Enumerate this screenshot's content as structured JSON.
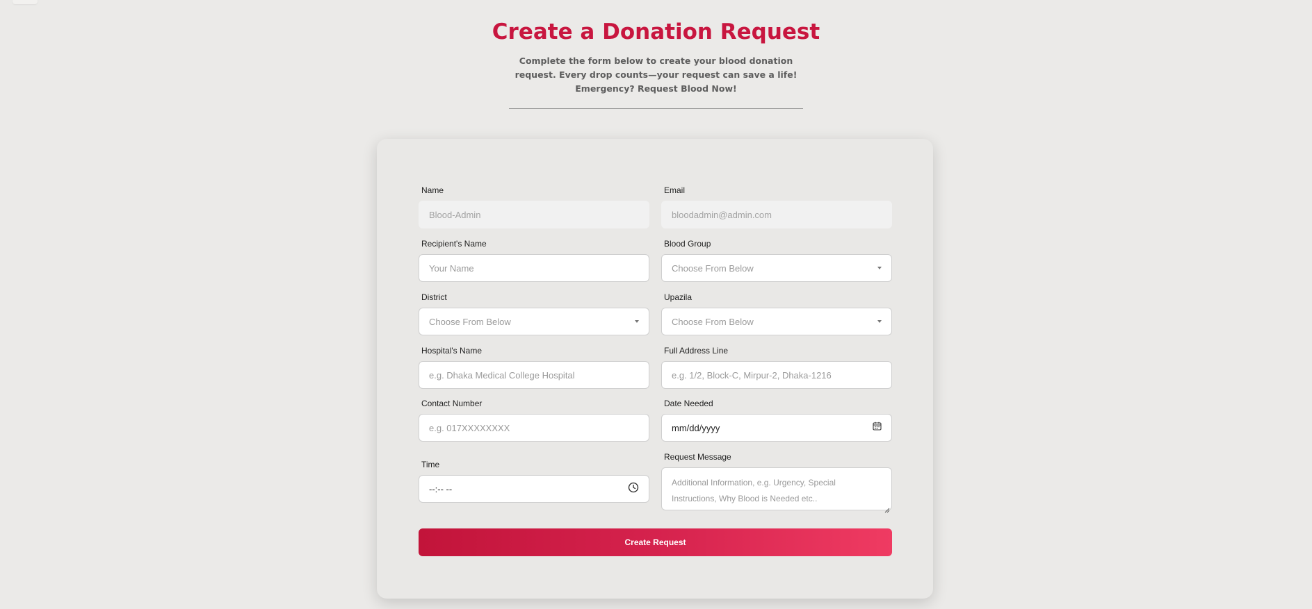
{
  "page": {
    "title": "Create a Donation Request",
    "subtitle": "Complete the form below to create your blood donation request. Every drop counts—your request can save a life! Emergency? Request Blood Now!"
  },
  "form": {
    "name": {
      "label": "Name",
      "placeholder": "Blood-Admin"
    },
    "email": {
      "label": "Email",
      "placeholder": "bloodadmin@admin.com"
    },
    "recipient_name": {
      "label": "Recipient's Name",
      "placeholder": "Your Name"
    },
    "blood_group": {
      "label": "Blood Group",
      "selected": "Choose From Below"
    },
    "district": {
      "label": "District",
      "selected": "Choose From Below"
    },
    "upazila": {
      "label": "Upazila",
      "selected": "Choose From Below"
    },
    "hospital_name": {
      "label": "Hospital's Name",
      "placeholder": "e.g. Dhaka Medical College Hospital"
    },
    "address": {
      "label": "Full Address Line",
      "placeholder": "e.g. 1/2, Block-C, Mirpur-2, Dhaka-1216"
    },
    "contact_number": {
      "label": "Contact Number",
      "placeholder": "e.g. 017XXXXXXXX"
    },
    "date_needed": {
      "label": "Date Needed",
      "value": "mm/dd/yyyy"
    },
    "time": {
      "label": "Time",
      "value": "--:-- --"
    },
    "request_message": {
      "label": "Request Message",
      "placeholder": "Additional Information, e.g. Urgency, Special Instructions, Why Blood is Needed etc.."
    },
    "submit_label": "Create Request"
  },
  "icons": {
    "select": "chevron-down-icon",
    "date": "calendar-icon",
    "time": "clock-icon"
  },
  "colors": {
    "accent": "#c8163f",
    "button_gradient_start": "#c2143a",
    "button_gradient_end": "#ef3b62",
    "background": "#ebeae8"
  }
}
